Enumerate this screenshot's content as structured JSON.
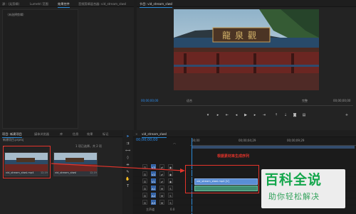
{
  "left_panel": {
    "tabs": [
      "源：(无剪辑)",
      "Lumetri 范围",
      "效果控件",
      "音频剪辑混合器: vid_stream_slwsl"
    ],
    "content_label": "（未选择剪辑）"
  },
  "monitor": {
    "tab": "节目: vid_stream_slwsl",
    "timecode_left": "00;00;00;00",
    "fit_label": "适合",
    "fraction": "完整",
    "timecode_right": "00;00;00;00",
    "sign_text": "龍泉觀"
  },
  "bin": {
    "tabs": [
      "项目: 新建项目",
      "媒体浏览器",
      "库",
      "信息",
      "效果",
      "标记"
    ],
    "project_file": "新建项目.prproj",
    "count_label": "1 项已选择，共 2 项",
    "items": [
      {
        "name": "vid_stream_slwsl.mp4",
        "duration": "12;19"
      },
      {
        "name": "vid_stream_slwsl",
        "duration": "12;19"
      }
    ]
  },
  "timeline": {
    "tab": "vid_stream_slwsl",
    "timecode": "00;00;00;00",
    "ruler": [
      "00;00",
      "00;00;04;29",
      "00;00;09;29"
    ],
    "tracks_video": [
      "V3",
      "V2",
      "V1"
    ],
    "tracks_audio": [
      "A1",
      "A2",
      "A3"
    ],
    "master": "主声道",
    "master_value": "0.0",
    "video_clip_label": "vid_stream_slwsl.mp4 [V]",
    "annotation": "根据素材来生成序列"
  },
  "watermark": {
    "title": "百科全说",
    "subtitle": "助你轻松解决"
  }
}
